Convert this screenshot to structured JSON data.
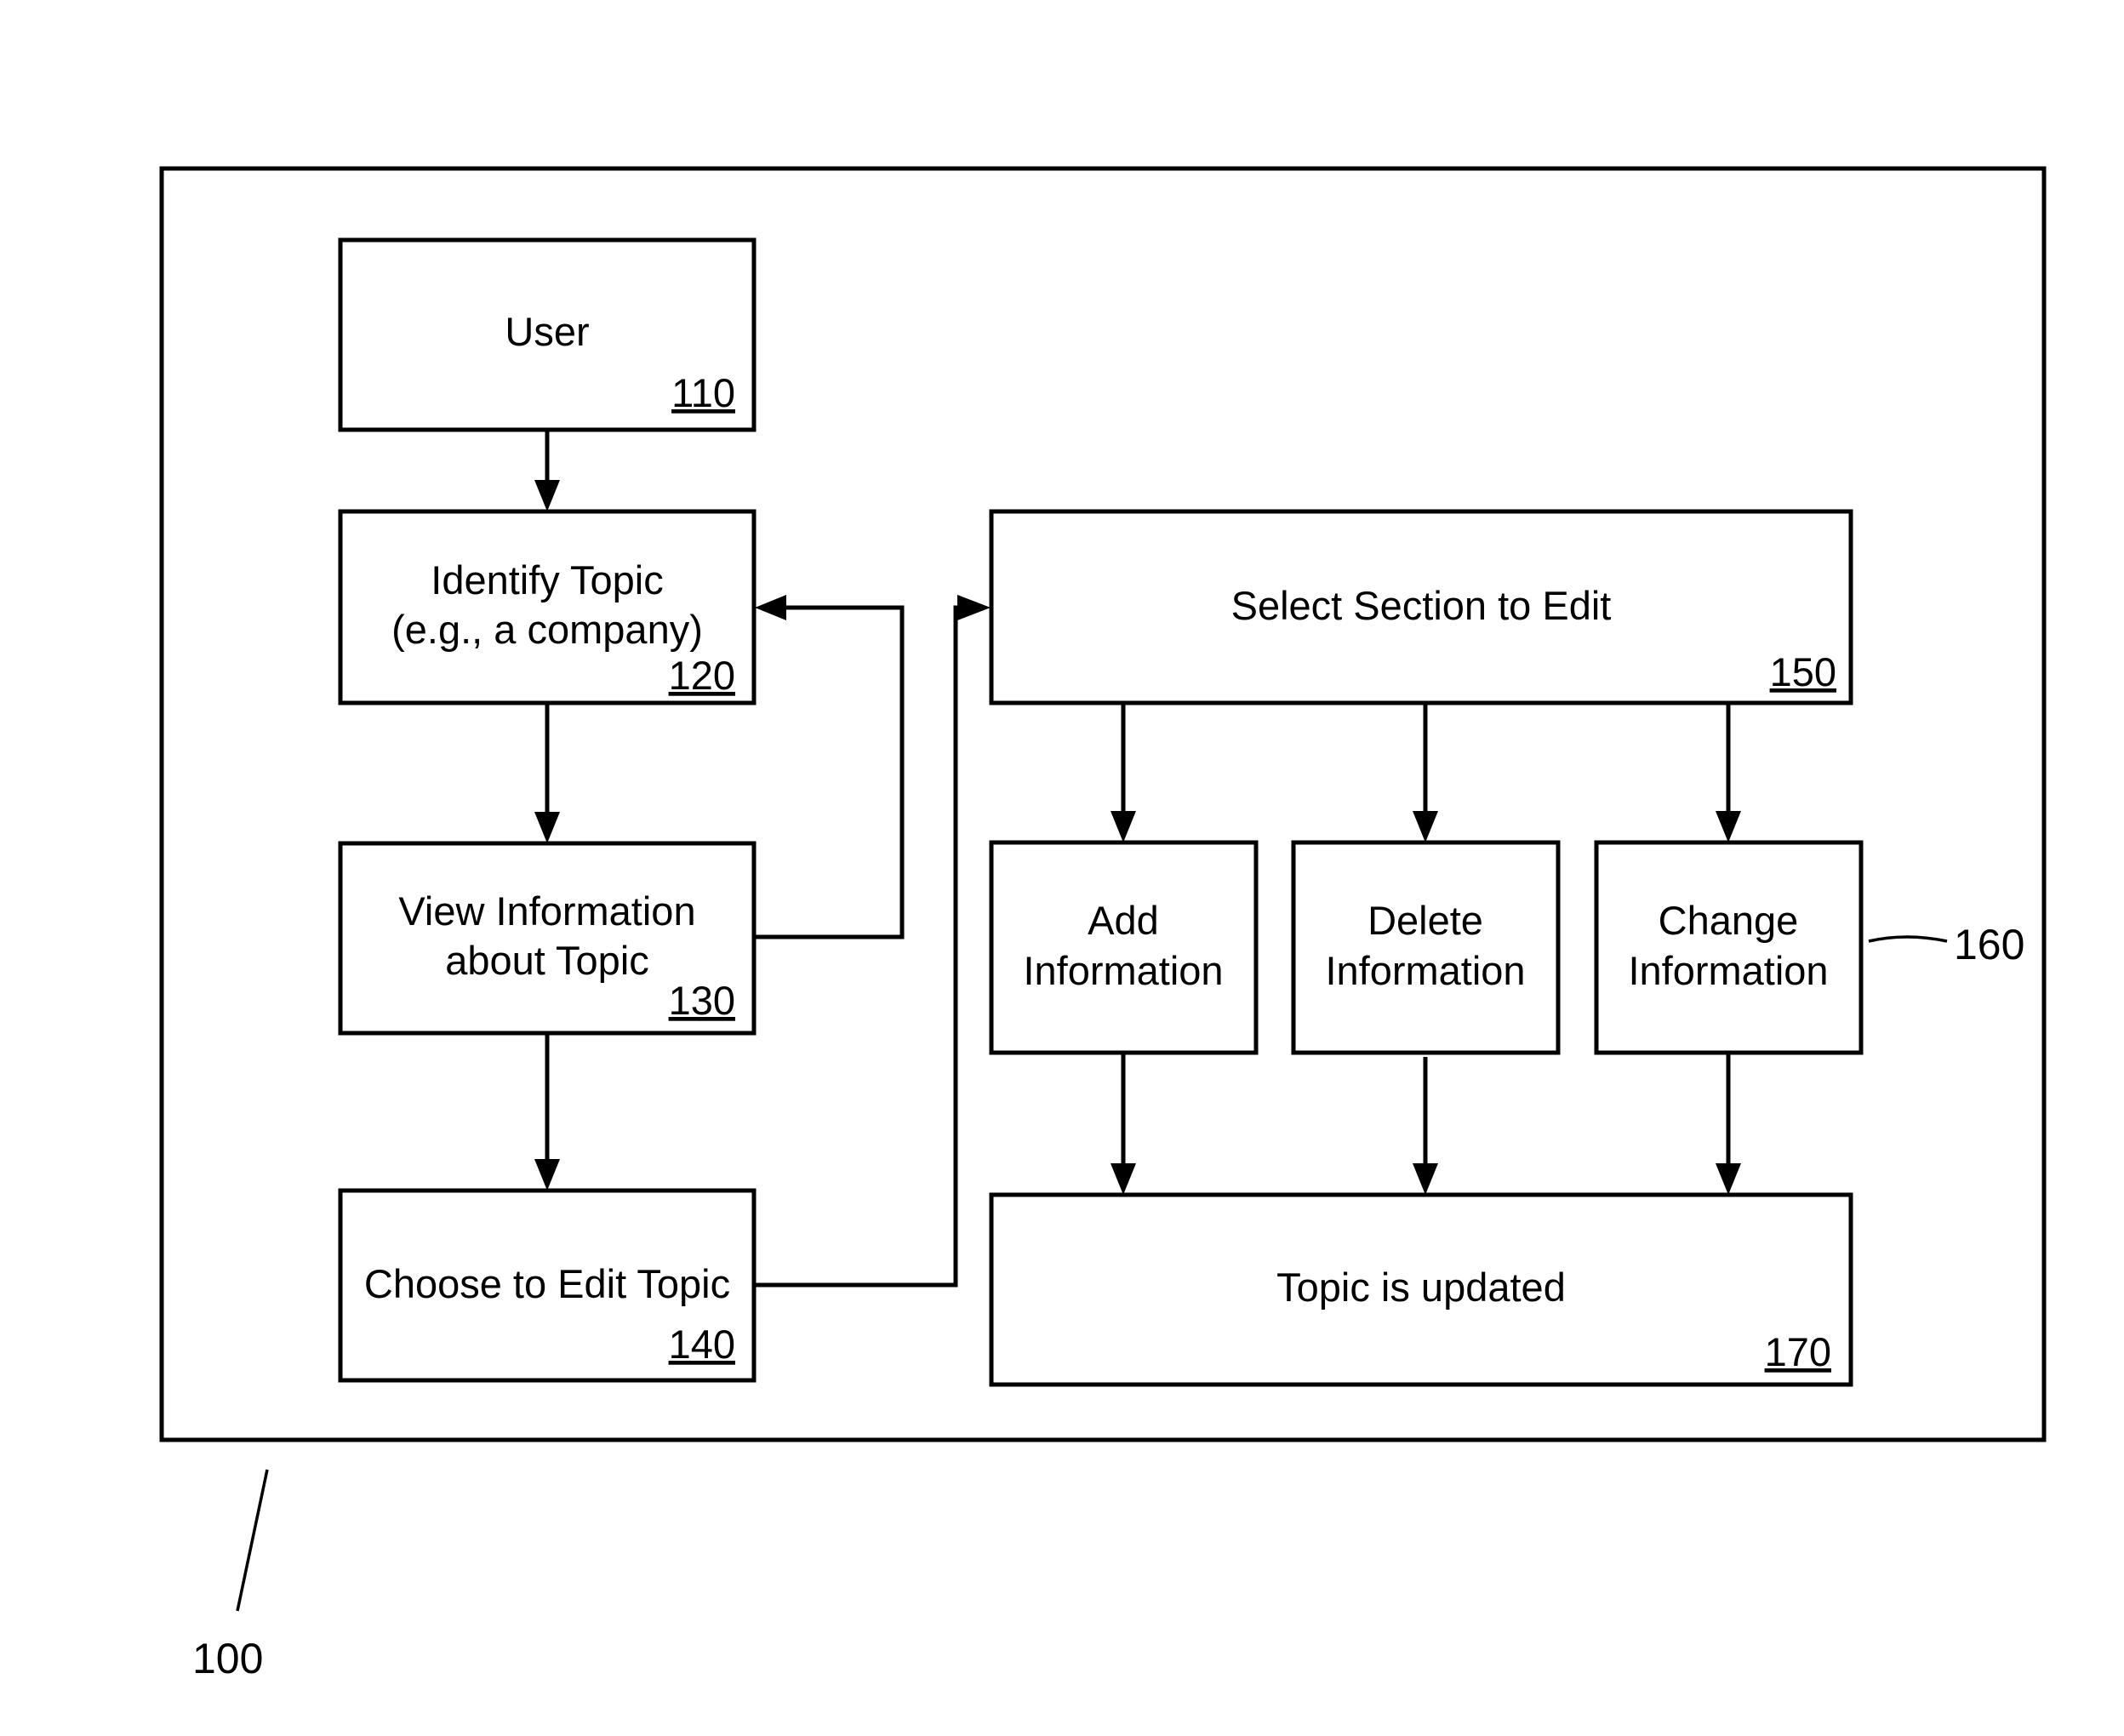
{
  "figure": {
    "reference": "100",
    "nodes": [
      {
        "id": "user",
        "lines": [
          "User"
        ],
        "ref": "110"
      },
      {
        "id": "identify",
        "lines": [
          "Identify Topic",
          "(e.g., a company)"
        ],
        "ref": "120"
      },
      {
        "id": "view",
        "lines": [
          "View Information",
          "about Topic"
        ],
        "ref": "130"
      },
      {
        "id": "choose",
        "lines": [
          "Choose to Edit Topic"
        ],
        "ref": "140"
      },
      {
        "id": "select",
        "lines": [
          "Select Section to Edit"
        ],
        "ref": "150"
      },
      {
        "id": "add",
        "lines": [
          "Add",
          "Information"
        ],
        "ref": ""
      },
      {
        "id": "delete",
        "lines": [
          "Delete",
          "Information"
        ],
        "ref": ""
      },
      {
        "id": "change",
        "lines": [
          "Change",
          "Information"
        ],
        "ref": ""
      },
      {
        "id": "updated",
        "lines": [
          "Topic is updated"
        ],
        "ref": "170"
      }
    ],
    "group_label": "160",
    "edges": [
      {
        "from": "user",
        "to": "identify"
      },
      {
        "from": "identify",
        "to": "view"
      },
      {
        "from": "view",
        "to": "identify"
      },
      {
        "from": "view",
        "to": "choose"
      },
      {
        "from": "choose",
        "to": "select"
      },
      {
        "from": "select",
        "to": "add"
      },
      {
        "from": "select",
        "to": "delete"
      },
      {
        "from": "select",
        "to": "change"
      },
      {
        "from": "add",
        "to": "updated"
      },
      {
        "from": "delete",
        "to": "updated"
      },
      {
        "from": "change",
        "to": "updated"
      }
    ]
  }
}
